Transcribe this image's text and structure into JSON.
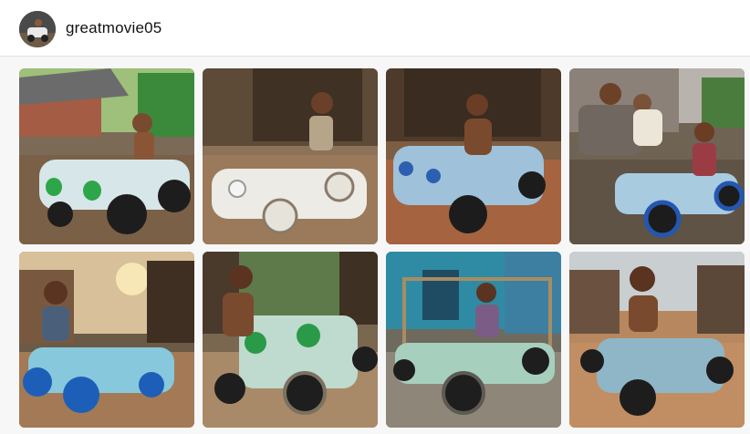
{
  "post": {
    "username": "greatmovie05",
    "avatar_icon": "user-avatar-icon"
  },
  "images": [
    {
      "scene": "sky-house",
      "car": "green-white"
    },
    {
      "scene": "hut",
      "car": "white"
    },
    {
      "scene": "hut-dark",
      "car": "blue-clear"
    },
    {
      "scene": "village-adults",
      "car": "blue-green"
    },
    {
      "scene": "sunset",
      "car": "blue-clear"
    },
    {
      "scene": "trees",
      "car": "green"
    },
    {
      "scene": "blue-wall",
      "car": "green-frame"
    },
    {
      "scene": "hills",
      "car": "clear-bottles"
    }
  ],
  "colors": {
    "header_bg": "#ffffff",
    "feed_bg": "#f7f7f8",
    "text": "#111111"
  }
}
